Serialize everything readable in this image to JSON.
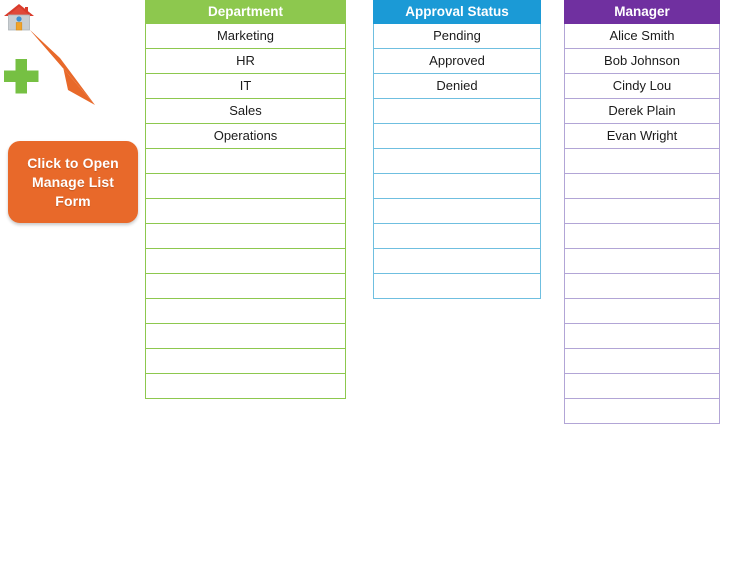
{
  "toolbar": {
    "home_icon": "home-icon",
    "add_icon": "plus-icon"
  },
  "callout": {
    "text": "Click to Open Manage List Form",
    "color": "#E8692A",
    "text_color": "#FFFFFF"
  },
  "columns": [
    {
      "id": "department",
      "header": "Department",
      "header_color": "#8DC84E",
      "border_color": "#8DC84E",
      "total_rows": 15,
      "values": [
        "Marketing",
        "HR",
        "IT",
        "Sales",
        "Operations",
        "",
        "",
        "",
        "",
        "",
        "",
        "",
        "",
        "",
        ""
      ]
    },
    {
      "id": "approval-status",
      "header": "Approval Status",
      "header_color": "#1B9AD6",
      "border_color": "#6FBFE0",
      "total_rows": 11,
      "values": [
        "Pending",
        "Approved",
        "Denied",
        "",
        "",
        "",
        "",
        "",
        "",
        "",
        ""
      ]
    },
    {
      "id": "manager",
      "header": "Manager",
      "header_color": "#7030A0",
      "border_color": "#B2A5D6",
      "total_rows": 16,
      "values": [
        "Alice Smith",
        "Bob Johnson",
        "Cindy Lou",
        "Derek Plain",
        "Evan Wright",
        "",
        "",
        "",
        "",
        "",
        "",
        "",
        "",
        "",
        "",
        ""
      ]
    }
  ]
}
